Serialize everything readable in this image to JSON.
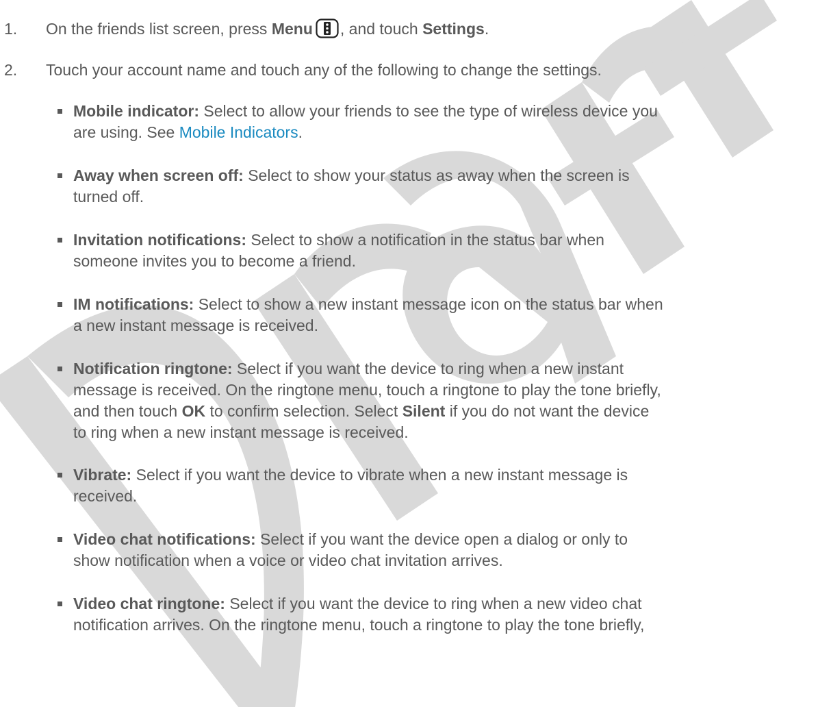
{
  "steps": [
    {
      "num": "1.",
      "pre": "On the friends list screen, press ",
      "menu": "Menu",
      "icon": "menu-key-icon",
      "mid": ", and touch ",
      "settings": "Settings",
      "post": "."
    },
    {
      "num": "2.",
      "text": "Touch your account name and touch any of the following to change the settings."
    }
  ],
  "bullets": [
    {
      "term": "Mobile indicator:",
      "l1": " Select to allow your friends to see the type of wireless device you",
      "l2_pre": "are using. See ",
      "link": "Mobile Indicators",
      "l2_post": "."
    },
    {
      "term": "Away when screen off:",
      "l1": " Select to show your status as away when the screen is",
      "l2": "turned off."
    },
    {
      "term": "Invitation notifications:",
      "l1": " Select to show a notification in the status bar when",
      "l2": "someone invites you to become a friend."
    },
    {
      "term": "IM notifications:",
      "l1": " Select to show a new instant message icon on the status bar when",
      "l2": "a new instant message is received."
    },
    {
      "term": "Notification ringtone:",
      "l1": " Select if you want the device to ring when a new instant",
      "l2": "message is received. On the ringtone menu, touch a ringtone to play the tone briefly,",
      "l3_pre": "and then touch ",
      "ok": "OK",
      "l3_mid": " to confirm selection. Select ",
      "silent": "Silent",
      "l3_post": " if you do not want the device",
      "l4": "to ring when a new instant message is received."
    },
    {
      "term": "Vibrate:",
      "l1": " Select if you want the device to vibrate when a new instant message is",
      "l2": "received."
    },
    {
      "term": "Video chat notifications:",
      "l1": " Select if you want the device open a dialog or only to",
      "l2": "show notification when a voice or video chat invitation arrives."
    },
    {
      "term": "Video chat ringtone:",
      "l1": " Select if you want the device to ring when a new video chat",
      "l2": "notification arrives. On the ringtone menu, touch a ringtone to play the tone briefly,"
    }
  ],
  "watermark": {
    "text": "Draft",
    "color": "#d9d9d9"
  },
  "colors": {
    "text": "#595959",
    "link": "#1a8ac0"
  }
}
